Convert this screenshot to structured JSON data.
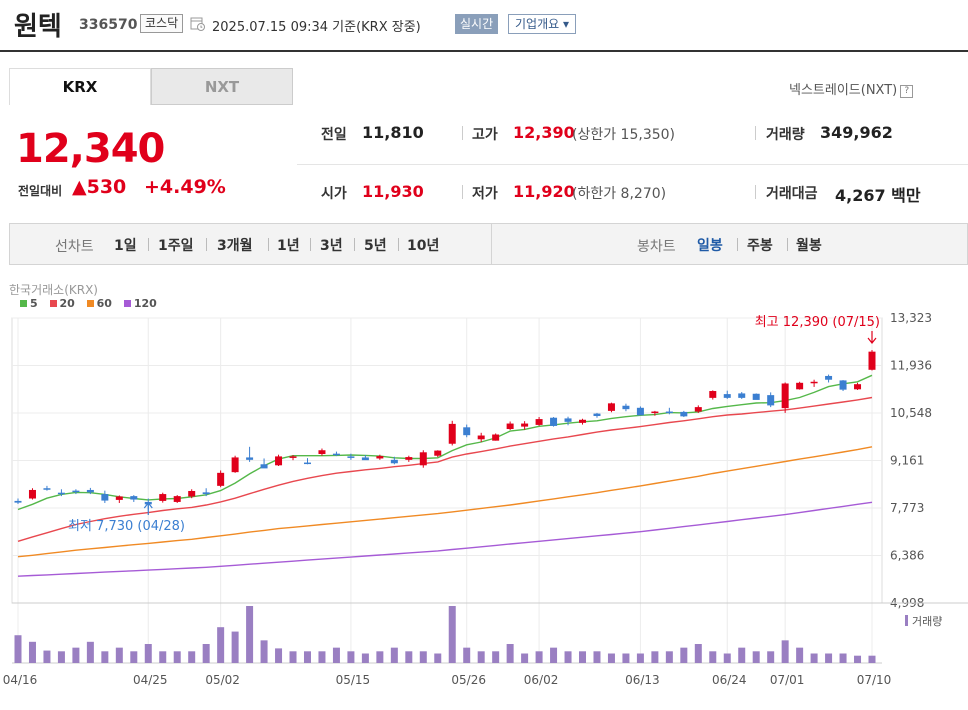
{
  "header": {
    "name": "원텍",
    "code": "336570",
    "market": "코스닥",
    "time": "2025.07.15 09:34 기준(KRX 장중)",
    "realtime": "실시간",
    "company_info": "기업개요 ▾"
  },
  "tabs": [
    "KRX",
    "NXT"
  ],
  "nextrade": {
    "label": "넥스트레이드(NXT)",
    "help": "?"
  },
  "price": {
    "current": "12,340",
    "change_label": "전일대비",
    "change": "▲530",
    "change_pct": "+4.49%"
  },
  "stats": {
    "prev_label": "전일",
    "prev": "11,810",
    "high_label": "고가",
    "high": "12,390",
    "upper_limit": "(상한가 15,350)",
    "volume_label": "거래량",
    "volume": "349,962",
    "open_label": "시가",
    "open": "11,930",
    "low_label": "저가",
    "low": "11,920",
    "lower_limit": "(하한가 8,270)",
    "amount_label": "거래대금",
    "amount": "4,267 백만"
  },
  "toolbar": {
    "line_label": "선차트",
    "periods": [
      "1일",
      "1주일",
      "3개월",
      "1년",
      "3년",
      "5년",
      "10년"
    ],
    "candle_label": "봉차트",
    "candles": [
      "일봉",
      "주봉",
      "월봉"
    ]
  },
  "chart_meta": {
    "source": "한국거래소(KRX)",
    "volume_label": "거래량",
    "max_annot": "최고 12,390 (07/15)",
    "min_annot": "최저 7,730 (04/28)"
  },
  "colors": {
    "up": "#e0001b",
    "down": "#3b7fd1",
    "ma5": "#55b84a",
    "ma20": "#e8484f",
    "ma60": "#f08a24",
    "ma120": "#a65bd6",
    "volume": "#9a7fc2"
  },
  "chart_data": {
    "type": "candlestick",
    "y_ticks": [
      "13,323",
      "11,936",
      "10,548",
      "9,161",
      "7,773",
      "6,386",
      "4,998"
    ],
    "y_range": [
      4998,
      13323
    ],
    "x_ticks": [
      "04/16",
      "04/25",
      "05/02",
      "05/15",
      "05/26",
      "06/02",
      "06/13",
      "06/24",
      "07/01",
      "07/10"
    ],
    "legend": [
      {
        "name": "5",
        "color": "#55b84a"
      },
      {
        "name": "20",
        "color": "#e8484f"
      },
      {
        "name": "60",
        "color": "#f08a24"
      },
      {
        "name": "120",
        "color": "#a65bd6"
      }
    ],
    "candles": [
      [
        7980,
        8050,
        7890,
        7930
      ],
      [
        8050,
        8350,
        8020,
        8300
      ],
      [
        8350,
        8420,
        8280,
        8320
      ],
      [
        8220,
        8320,
        8120,
        8180
      ],
      [
        8280,
        8320,
        8180,
        8240
      ],
      [
        8300,
        8360,
        8180,
        8230
      ],
      [
        8180,
        8280,
        7920,
        7990
      ],
      [
        8010,
        8140,
        7920,
        8110
      ],
      [
        8120,
        8150,
        7950,
        8020
      ],
      [
        7950,
        8050,
        7730,
        7880
      ],
      [
        7980,
        8220,
        7930,
        8180
      ],
      [
        7950,
        8150,
        7920,
        8120
      ],
      [
        8110,
        8320,
        8060,
        8270
      ],
      [
        8230,
        8350,
        8120,
        8180
      ],
      [
        8420,
        8870,
        8380,
        8800
      ],
      [
        8820,
        9300,
        8800,
        9250
      ],
      [
        9250,
        9560,
        9120,
        9180
      ],
      [
        9050,
        9220,
        8990,
        8930
      ],
      [
        9020,
        9330,
        9000,
        9280
      ],
      [
        9260,
        9320,
        9170,
        9280
      ],
      [
        9100,
        9230,
        9050,
        9090
      ],
      [
        9350,
        9510,
        9300,
        9460
      ],
      [
        9360,
        9420,
        9290,
        9340
      ],
      [
        9280,
        9360,
        9180,
        9250
      ],
      [
        9250,
        9320,
        9190,
        9170
      ],
      [
        9220,
        9330,
        9180,
        9290
      ],
      [
        9180,
        9270,
        9050,
        9080
      ],
      [
        9180,
        9300,
        9120,
        9260
      ],
      [
        9020,
        9460,
        8950,
        9400
      ],
      [
        9300,
        9460,
        9260,
        9450
      ],
      [
        9650,
        10320,
        9600,
        10230
      ],
      [
        10130,
        10210,
        9840,
        9900
      ],
      [
        9780,
        9970,
        9700,
        9890
      ],
      [
        9740,
        9950,
        9740,
        9920
      ],
      [
        10080,
        10300,
        10050,
        10240
      ],
      [
        10150,
        10310,
        10060,
        10240
      ],
      [
        10200,
        10430,
        10170,
        10370
      ],
      [
        10410,
        10430,
        10150,
        10170
      ],
      [
        10390,
        10440,
        10190,
        10290
      ],
      [
        10260,
        10380,
        10210,
        10350
      ],
      [
        10530,
        10550,
        10410,
        10460
      ],
      [
        10610,
        10850,
        10570,
        10830
      ],
      [
        10760,
        10820,
        10600,
        10660
      ],
      [
        10700,
        10740,
        10540,
        10480
      ],
      [
        10560,
        10610,
        10470,
        10590
      ],
      [
        10590,
        10700,
        10510,
        10560
      ],
      [
        10580,
        10610,
        10430,
        10450
      ],
      [
        10590,
        10770,
        10550,
        10720
      ],
      [
        10990,
        11210,
        10940,
        11190
      ],
      [
        11100,
        11200,
        10960,
        10990
      ],
      [
        11120,
        11160,
        10960,
        10990
      ],
      [
        11110,
        11120,
        10950,
        10930
      ],
      [
        11070,
        11150,
        10720,
        10770
      ],
      [
        10690,
        11440,
        10550,
        11410
      ],
      [
        11240,
        11460,
        11230,
        11430
      ],
      [
        11430,
        11520,
        11310,
        11460
      ],
      [
        11630,
        11670,
        11440,
        11520
      ],
      [
        11500,
        11510,
        11190,
        11230
      ],
      [
        11240,
        11430,
        11220,
        11390
      ],
      [
        11810,
        12390,
        11790,
        12340
      ]
    ],
    "volumes": [
      38,
      29,
      17,
      16,
      21,
      29,
      16,
      21,
      16,
      26,
      16,
      16,
      16,
      26,
      49,
      43,
      78,
      31,
      20,
      16,
      16,
      16,
      21,
      16,
      13,
      16,
      21,
      16,
      16,
      13,
      78,
      21,
      16,
      16,
      26,
      13,
      16,
      21,
      16,
      16,
      16,
      13,
      13,
      13,
      16,
      16,
      21,
      26,
      16,
      13,
      21,
      16,
      16,
      31,
      21,
      13,
      13,
      13,
      10,
      10
    ],
    "ma5": [
      7730,
      7880,
      8060,
      8170,
      8230,
      8220,
      8170,
      8100,
      8050,
      8010,
      8040,
      8050,
      8100,
      8160,
      8280,
      8500,
      8770,
      9010,
      9200,
      9300,
      9300,
      9300,
      9310,
      9320,
      9310,
      9290,
      9240,
      9220,
      9220,
      9240,
      9450,
      9620,
      9700,
      9820,
      10020,
      10070,
      10160,
      10200,
      10250,
      10290,
      10320,
      10390,
      10440,
      10480,
      10500,
      10560,
      10550,
      10580,
      10680,
      10740,
      10790,
      10840,
      10850,
      10910,
      11000,
      11150,
      11320,
      11400,
      11460,
      11650
    ],
    "ma20": [
      6800,
      6930,
      7050,
      7170,
      7290,
      7380,
      7460,
      7530,
      7590,
      7640,
      7700,
      7750,
      7790,
      7860,
      7950,
      8060,
      8190,
      8320,
      8440,
      8550,
      8640,
      8720,
      8790,
      8840,
      8890,
      8930,
      8980,
      9020,
      9070,
      9120,
      9260,
      9350,
      9420,
      9500,
      9580,
      9650,
      9720,
      9790,
      9850,
      9920,
      9990,
      10050,
      10100,
      10150,
      10210,
      10270,
      10320,
      10380,
      10440,
      10490,
      10520,
      10560,
      10600,
      10640,
      10690,
      10750,
      10810,
      10870,
      10930,
      11000
    ],
    "ma60": [
      6350,
      6390,
      6440,
      6490,
      6540,
      6580,
      6620,
      6660,
      6700,
      6740,
      6780,
      6820,
      6860,
      6910,
      6960,
      7010,
      7070,
      7120,
      7170,
      7210,
      7250,
      7290,
      7330,
      7370,
      7410,
      7450,
      7490,
      7530,
      7570,
      7610,
      7660,
      7710,
      7760,
      7810,
      7860,
      7920,
      7980,
      8040,
      8100,
      8160,
      8220,
      8290,
      8350,
      8420,
      8490,
      8560,
      8630,
      8700,
      8780,
      8850,
      8920,
      8990,
      9060,
      9130,
      9200,
      9270,
      9340,
      9410,
      9480,
      9560
    ],
    "ma120": [
      5780,
      5800,
      5820,
      5840,
      5860,
      5880,
      5900,
      5920,
      5940,
      5960,
      5980,
      6000,
      6020,
      6040,
      6070,
      6100,
      6130,
      6160,
      6190,
      6220,
      6250,
      6280,
      6310,
      6340,
      6370,
      6400,
      6430,
      6460,
      6490,
      6520,
      6560,
      6600,
      6640,
      6680,
      6720,
      6760,
      6800,
      6840,
      6880,
      6920,
      6960,
      7000,
      7040,
      7080,
      7130,
      7180,
      7230,
      7280,
      7330,
      7380,
      7430,
      7480,
      7530,
      7580,
      7640,
      7700,
      7760,
      7820,
      7880,
      7940
    ]
  }
}
